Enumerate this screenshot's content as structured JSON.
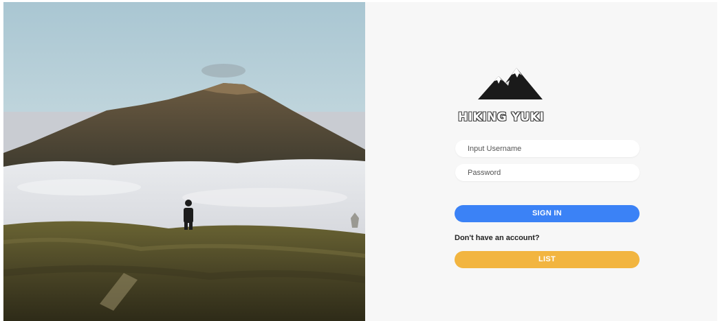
{
  "hero_image": {
    "description_icon": "mountain-landscape-image"
  },
  "brand": {
    "logo_icon": "mountain-logo-icon",
    "name": "HIKING YUKI"
  },
  "login_form": {
    "username_placeholder": "Input Username",
    "password_placeholder": "Password",
    "signin_label": "SIGN IN",
    "signup_prompt": "Don't have an account?",
    "list_label": "LIST"
  },
  "colors": {
    "panel_background": "#f7f7f7",
    "signin_button": "#3b82f6",
    "list_button": "#f2b540",
    "logo": "#1a1a1a"
  }
}
